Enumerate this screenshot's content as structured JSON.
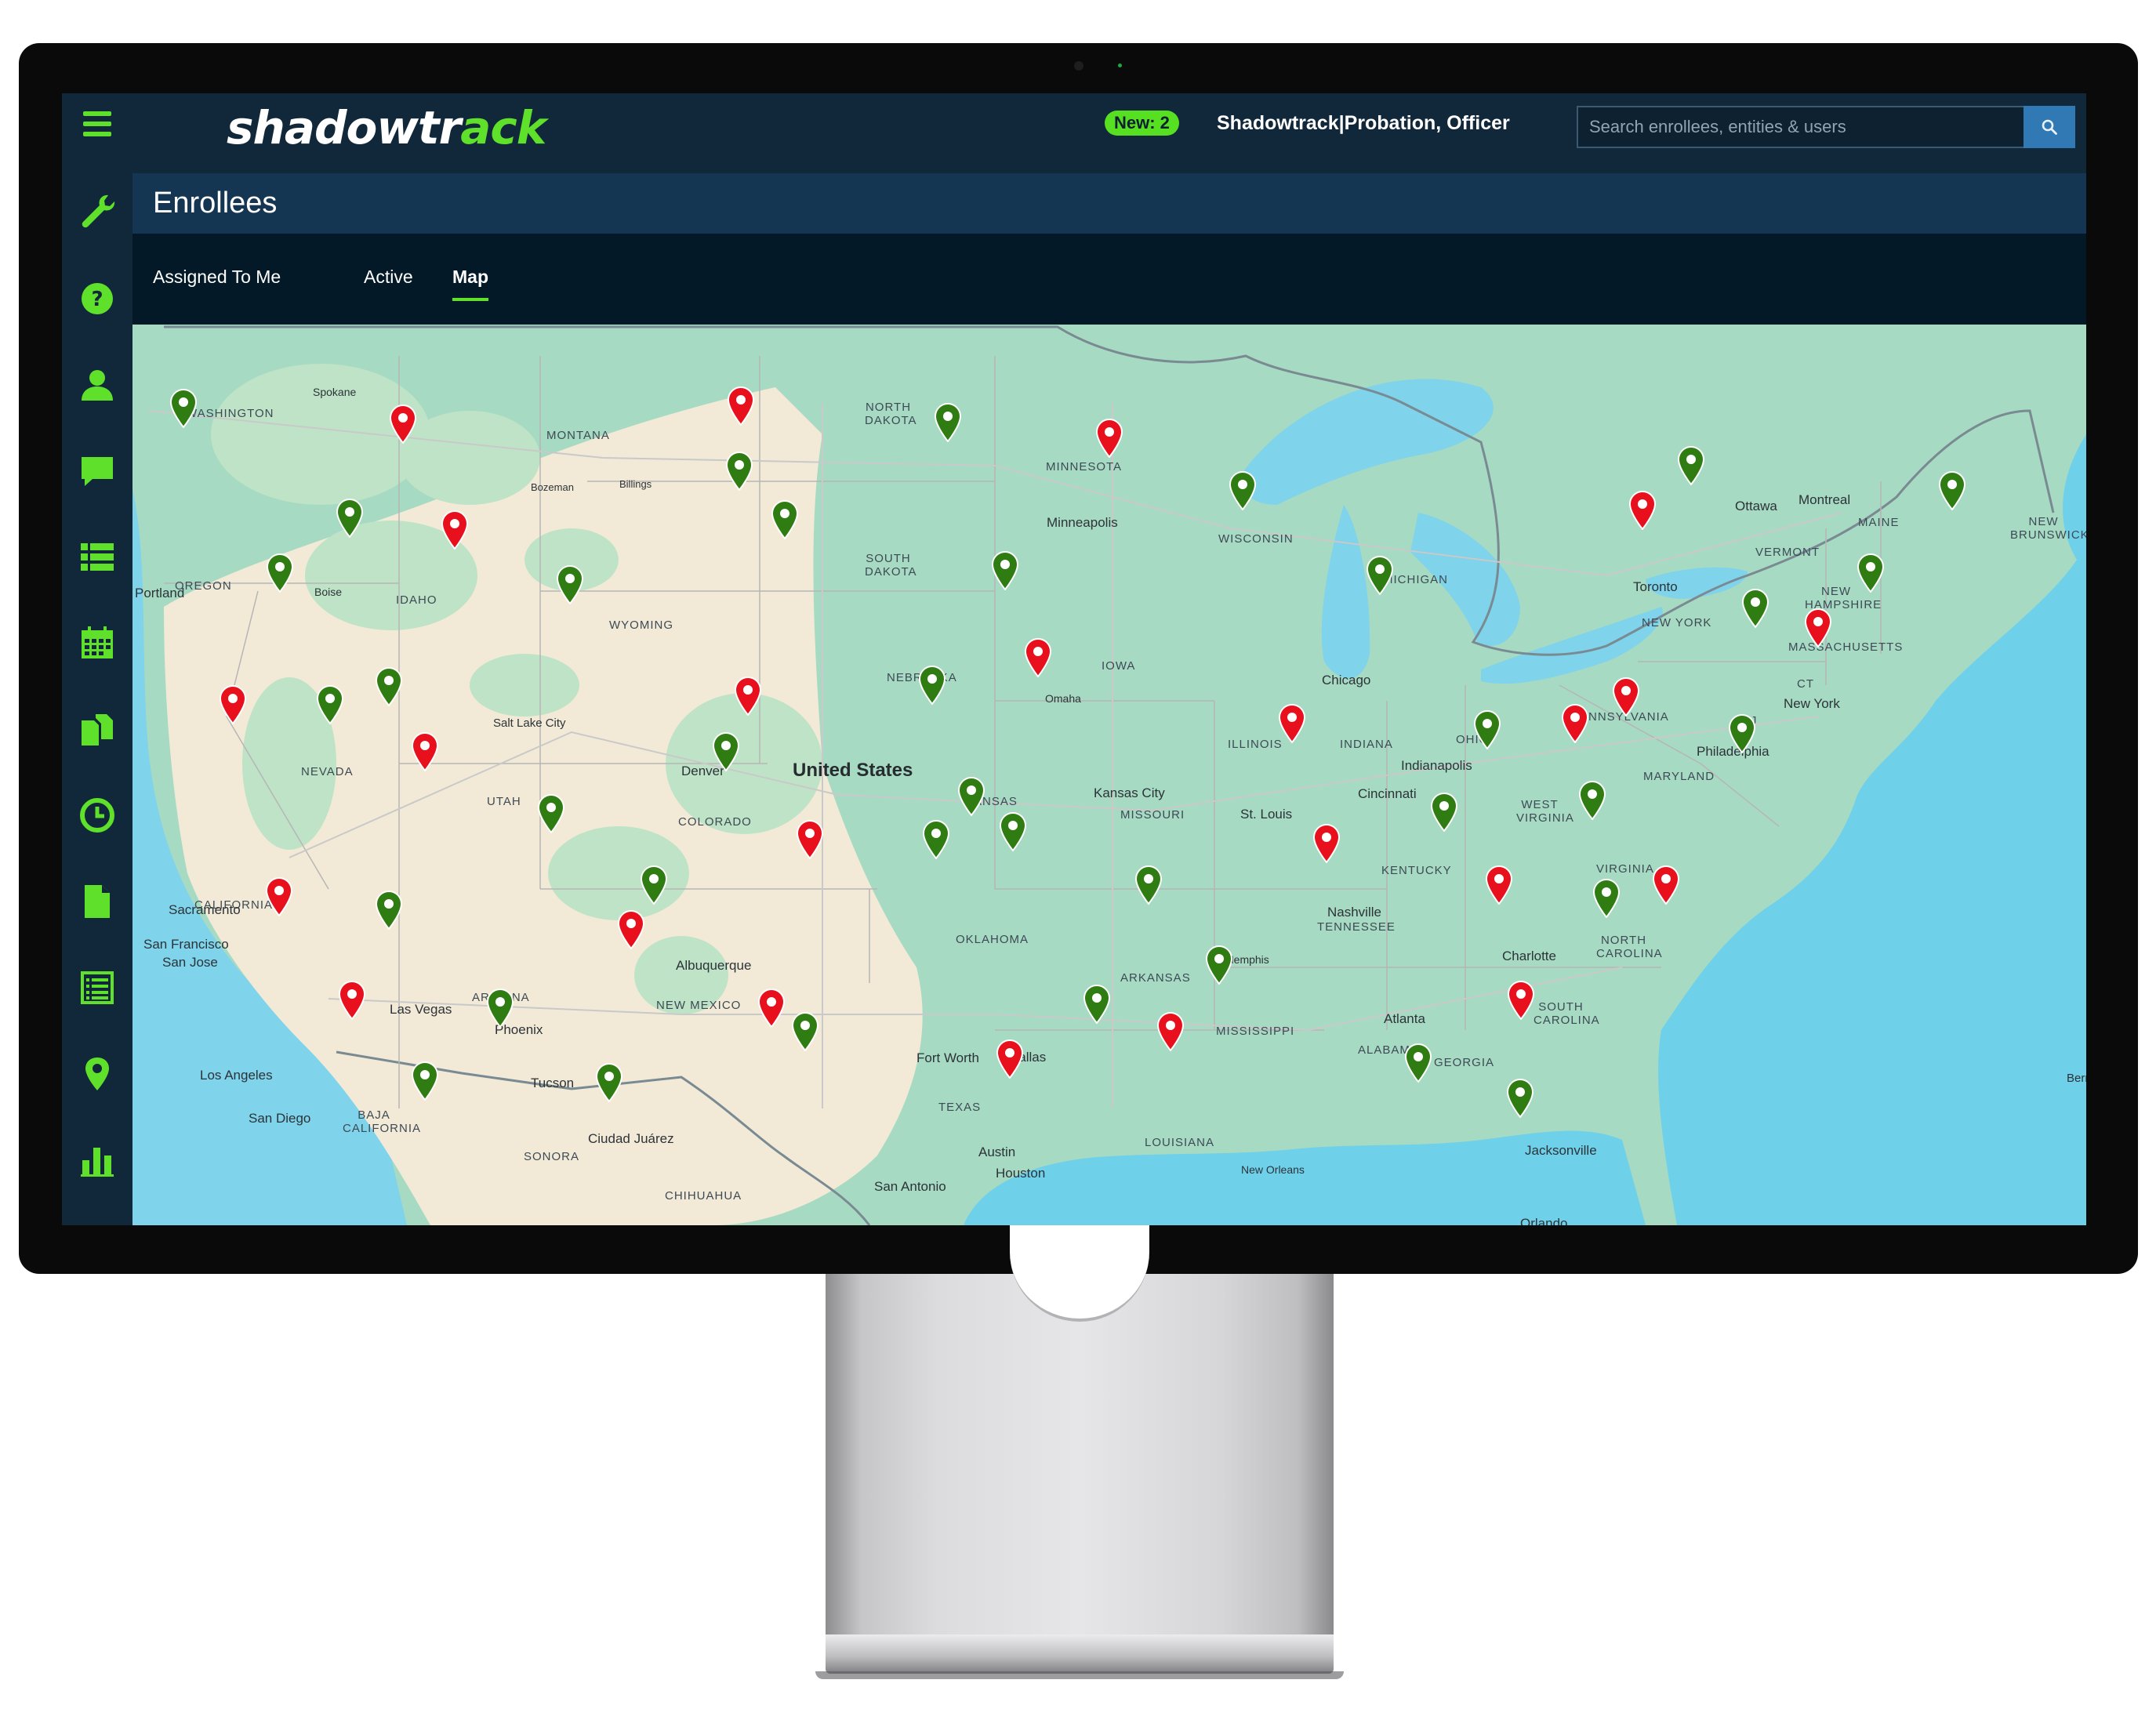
{
  "app": {
    "logo_prefix": "shadowtr",
    "logo_accent": "ack",
    "badge": "New: 2",
    "user": "Shadowtrack|Probation, Officer",
    "search_placeholder": "Search enrollees, entities & users"
  },
  "page": {
    "title": "Enrollees",
    "tabs": [
      "Assigned To Me",
      "Active",
      "Map"
    ],
    "active_tab": "Map"
  },
  "sidebar_icons": [
    "menu-icon",
    "wrench-icon",
    "help-icon",
    "person-icon",
    "chat-icon",
    "list-icon",
    "calendar-icon",
    "documents-icon",
    "clock-icon",
    "file-icon",
    "report-icon",
    "location-icon",
    "bar-chart-icon"
  ],
  "colors": {
    "accent": "#5fe02a",
    "header": "#10283a",
    "pin_alert": "#e8101c",
    "pin_ok": "#2f7d12"
  },
  "map": {
    "country_label": "United States",
    "state_labels": [
      "WASHINGTON",
      "OREGON",
      "IDAHO",
      "MONTANA",
      "WYOMING",
      "NORTH DAKOTA",
      "SOUTH DAKOTA",
      "NEBRASKA",
      "MINNESOTA",
      "WISCONSIN",
      "MICHIGAN",
      "IOWA",
      "ILLINOIS",
      "INDIANA",
      "OHIO",
      "PENNSYLVANIA",
      "NEW YORK",
      "VERMONT",
      "NEW HAMPSHIRE",
      "MAINE",
      "MASSACHUSETTS",
      "CT",
      "NJ",
      "MARYLAND",
      "WEST VIRGINIA",
      "VIRGINIA",
      "KENTUCKY",
      "TENNESSEE",
      "NORTH CAROLINA",
      "SOUTH CAROLINA",
      "GEORGIA",
      "ALABAMA",
      "MISSISSIPPI",
      "ARKANSAS",
      "LOUISIANA",
      "MISSOURI",
      "KANSAS",
      "OKLAHOMA",
      "TEXAS",
      "NEW MEXICO",
      "ARIZONA",
      "UTAH",
      "NEVADA",
      "COLORADO",
      "CALIFORNIA",
      "BAJA CALIFORNIA",
      "SONORA",
      "CHIHUAHUA",
      "NEW BRUNSWICK"
    ],
    "city_labels": [
      "Portland",
      "Spokane",
      "Boise",
      "Bozeman",
      "Billings",
      "Salt Lake City",
      "Sacramento",
      "San Francisco",
      "San Jose",
      "Las Vegas",
      "Los Angeles",
      "San Diego",
      "Phoenix",
      "Tucson",
      "Ciudad Juárez",
      "Albuquerque",
      "Denver",
      "Minneapolis",
      "Omaha",
      "Kansas City",
      "St. Louis",
      "Chicago",
      "Indianapolis",
      "Cincinnati",
      "Nashville",
      "Memphis",
      "Atlanta",
      "Charlotte",
      "Toronto",
      "Ottawa",
      "Montreal",
      "Philadelphia",
      "New York",
      "Jacksonville",
      "Orlando",
      "New Orleans",
      "Houston",
      "Austin",
      "San Antonio",
      "Dallas",
      "Fort Worth",
      "Bermuda"
    ]
  }
}
